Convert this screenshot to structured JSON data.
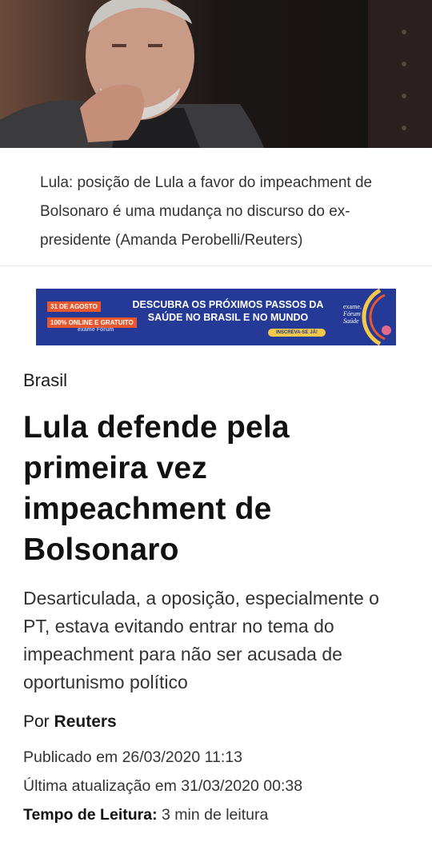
{
  "hero": {
    "image_name": "lula-photo"
  },
  "caption": {
    "text": "Lula: posição de Lula a favor do impeachment de Bolsonaro é uma mudança no discurso do ex-presidente (Amanda Perobelli/Reuters)"
  },
  "ad": {
    "date": "31 DE AGOSTO",
    "format": "100% ONLINE E GRATUITO",
    "logos": "exame   Fórum",
    "headline_line1": "DESCUBRA OS PRÓXIMOS PASSOS DA",
    "headline_line2": "SAÚDE NO BRASIL E NO MUNDO",
    "button": "INSCREVA-SE JÁ!",
    "brand_line1": "exame.",
    "brand_line2": "Fórum",
    "brand_line3": "Saúde",
    "colors": {
      "background": "#243a96",
      "accent": "#e9572e",
      "button": "#f6c84a"
    }
  },
  "article": {
    "category": "Brasil",
    "title": "Lula defende pela primeira vez impeachment de Bolsonaro",
    "lede": "Desarticulada, a oposição, especialmente o PT, estava evitando entrar no tema do impeachment para não ser acusada de oportunismo político",
    "author_prefix": "Por",
    "author": "Reuters",
    "published": "Publicado em 26/03/2020 11:13",
    "updated": "Última atualização em 31/03/2020 00:38",
    "reading_time_label": "Tempo de Leitura:",
    "reading_time_value": "3 min de leitura"
  }
}
